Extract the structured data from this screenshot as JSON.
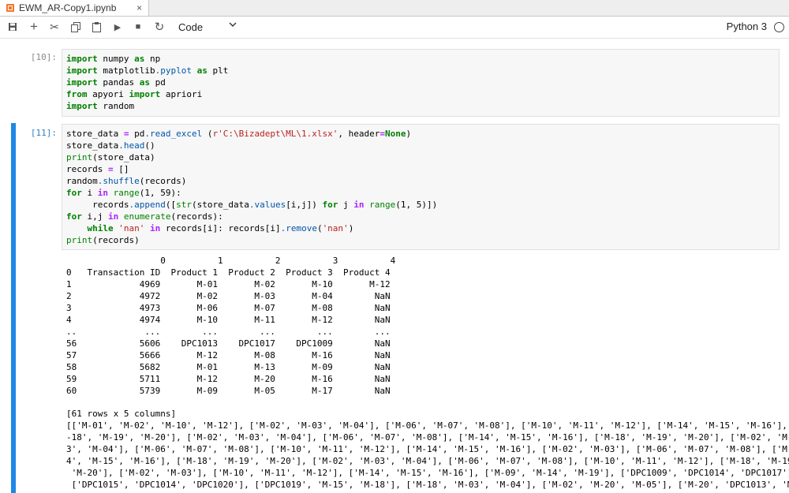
{
  "tab": {
    "title": "EWM_AR-Copy1.ipynb",
    "close": "×"
  },
  "toolbar": {
    "buttons": [
      {
        "name": "save-icon",
        "glyph": "💾"
      },
      {
        "name": "add-cell-icon",
        "glyph": "+"
      },
      {
        "name": "cut-icon",
        "glyph": "✂"
      },
      {
        "name": "copy-icon",
        "glyph": "⧉"
      },
      {
        "name": "paste-icon",
        "glyph": "📋"
      },
      {
        "name": "run-icon",
        "glyph": "▶"
      },
      {
        "name": "stop-icon",
        "glyph": "■"
      },
      {
        "name": "restart-icon",
        "glyph": "↻"
      }
    ],
    "cell_type": "Code",
    "kernel": "Python 3"
  },
  "cells": {
    "c10": {
      "prompt": "[10]:"
    },
    "c11": {
      "prompt": "[11]:"
    }
  },
  "output": {
    "dataframe": [
      "                  0          1          2          3          4",
      "0   Transaction ID  Product 1  Product 2  Product 3  Product 4",
      "1             4969       M-01       M-02       M-10       M-12",
      "2             4972       M-02       M-03       M-04        NaN",
      "3             4973       M-06       M-07       M-08        NaN",
      "4             4974       M-10       M-11       M-12        NaN",
      "..             ...        ...        ...        ...        ...",
      "56            5606    DPC1013    DPC1017    DPC1009        NaN",
      "57            5666       M-12       M-08       M-16        NaN",
      "58            5682       M-01       M-13       M-09        NaN",
      "59            5711       M-12       M-20       M-16        NaN",
      "60            5739       M-09       M-05       M-17        NaN"
    ],
    "summary": "[61 rows x 5 columns]",
    "records": [
      "[['M-01', 'M-02', 'M-10', 'M-12'], ['M-02', 'M-03', 'M-04'], ['M-06', 'M-07', 'M-08'], ['M-10', 'M-11', 'M-12'], ['M-14', 'M-15', 'M-16'], ['M",
      "-18', 'M-19', 'M-20'], ['M-02', 'M-03', 'M-04'], ['M-06', 'M-07', 'M-08'], ['M-14', 'M-15', 'M-16'], ['M-18', 'M-19', 'M-20'], ['M-02', 'M-0",
      "3', 'M-04'], ['M-06', 'M-07', 'M-08'], ['M-10', 'M-11', 'M-12'], ['M-14', 'M-15', 'M-16'], ['M-02', 'M-03'], ['M-06', 'M-07', 'M-08'], ['M-1",
      "4', 'M-15', 'M-16'], ['M-18', 'M-19', 'M-20'], ['M-02', 'M-03', 'M-04'], ['M-06', 'M-07', 'M-08'], ['M-10', 'M-11', 'M-12'], ['M-18', 'M-19',",
      " 'M-20'], ['M-02', 'M-03'], ['M-10', 'M-11', 'M-12'], ['M-14', 'M-15', 'M-16'], ['M-09', 'M-14', 'M-19'], ['DPC1009', 'DPC1014', 'DPC1017'],",
      " ['DPC1015', 'DPC1014', 'DPC1020'], ['DPC1019', 'M-15', 'M-18'], ['M-18', 'M-03', 'M-04'], ['M-02', 'M-20', 'M-05'], ['M-20', 'DPC1013', 'M-0"
    ]
  }
}
